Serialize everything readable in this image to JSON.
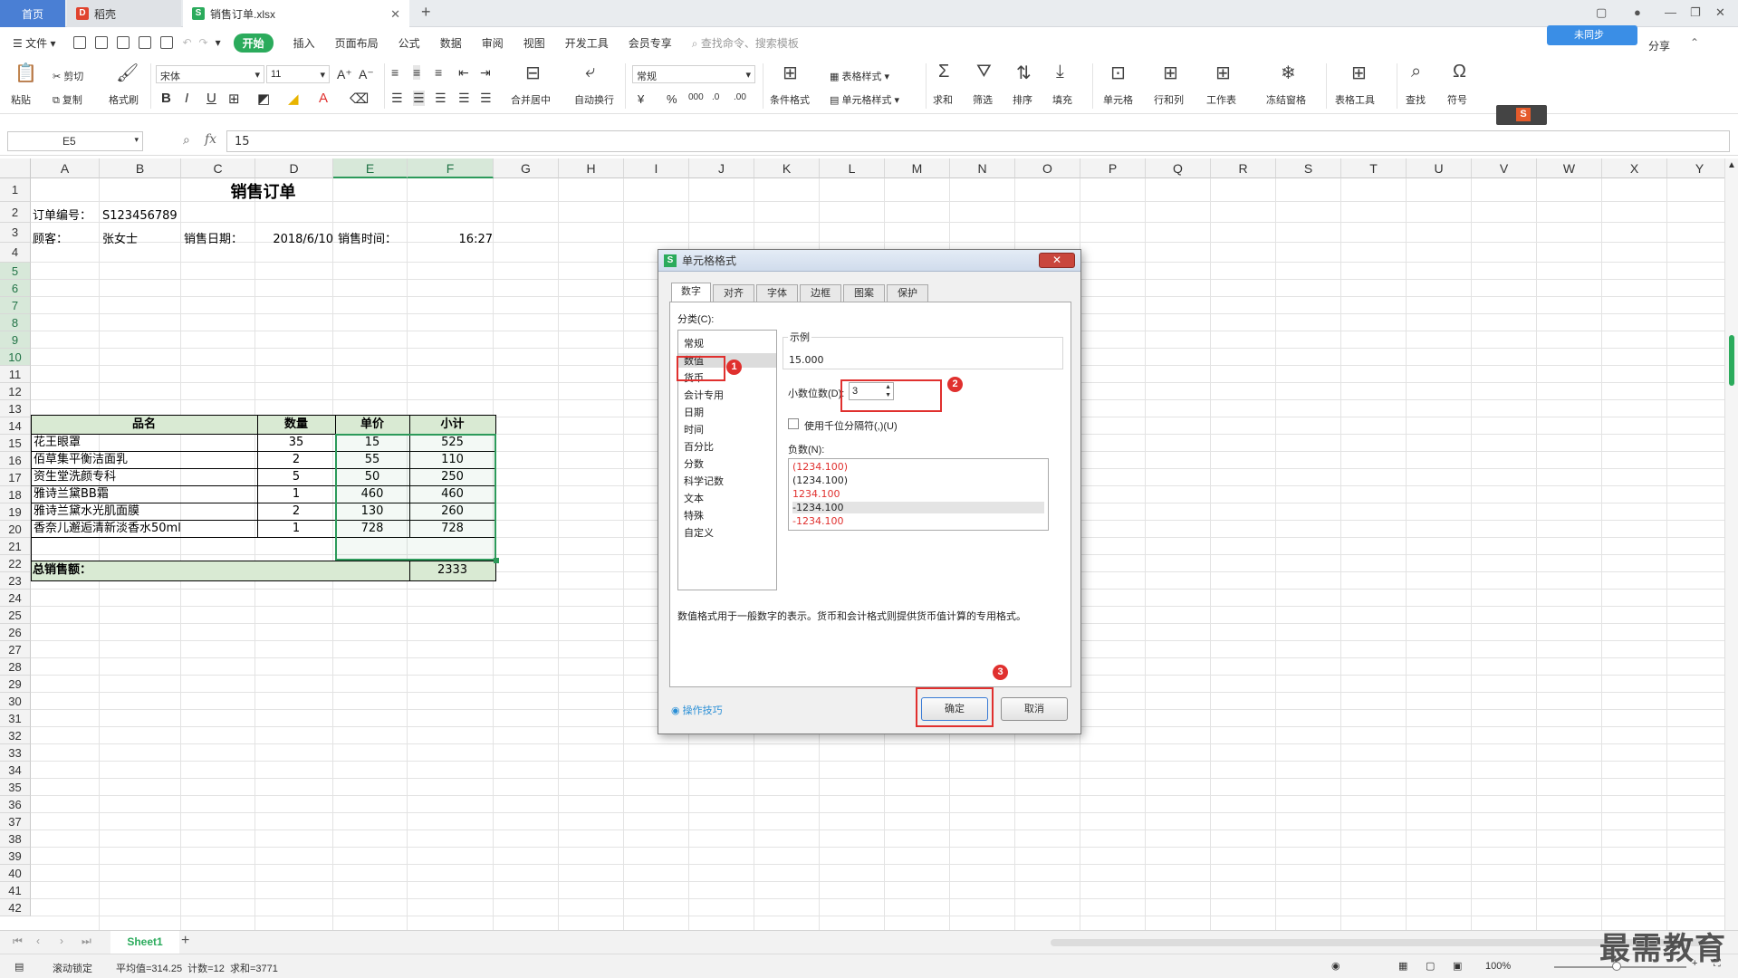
{
  "tabs": {
    "home": "首页",
    "daoke": "稻壳",
    "file": "销售订单.xlsx",
    "new_tab": "+"
  },
  "menu": {
    "file": "文件",
    "items": [
      "开始",
      "插入",
      "页面布局",
      "公式",
      "数据",
      "审阅",
      "视图",
      "开发工具",
      "会员专享"
    ],
    "search_placeholder": "查找命令、搜索模板",
    "cloud_badge": "未同步",
    "share": "分享"
  },
  "ribbon": {
    "paste": "粘贴",
    "cut": "剪切",
    "copy": "复制",
    "format_painter": "格式刷",
    "font_name": "宋体",
    "font_size": "11",
    "merge_center": "合并居中",
    "wrap": "自动换行",
    "number_format": "常规",
    "cond_format": "条件格式",
    "table_style": "表格样式",
    "cell_style": "单元格样式",
    "sum": "求和",
    "filter": "筛选",
    "sort": "排序",
    "fill": "填充",
    "cell": "单元格",
    "row_col": "行和列",
    "worksheet": "工作表",
    "freeze": "冻结窗格",
    "table_tools": "表格工具",
    "find": "查找",
    "symbol": "符号"
  },
  "formula_bar": {
    "cell_ref": "E5",
    "fx": "fx",
    "value": "15"
  },
  "columns": [
    "A",
    "B",
    "C",
    "D",
    "E",
    "F",
    "G",
    "H",
    "I",
    "J",
    "K",
    "L",
    "M",
    "N",
    "O",
    "P",
    "Q",
    "R",
    "S",
    "T",
    "U",
    "V",
    "W",
    "X",
    "Y"
  ],
  "rows": [
    "1",
    "2",
    "3",
    "4",
    "5",
    "6",
    "7",
    "8",
    "9",
    "10",
    "11",
    "12",
    "13",
    "14",
    "15",
    "16",
    "17",
    "18",
    "19",
    "20",
    "21",
    "22",
    "23",
    "24",
    "25",
    "26",
    "27",
    "28",
    "29",
    "30",
    "31",
    "32",
    "33",
    "34",
    "35",
    "36",
    "37",
    "38",
    "39",
    "40",
    "41",
    "42"
  ],
  "sheet": {
    "title": "销售订单",
    "order_label": "订单编号：",
    "order_no": "S123456789",
    "customer_label": "顾客：",
    "customer": "张女士",
    "date_label": "销售日期：",
    "date": "2018/6/10",
    "time_label": "销售时间：",
    "time": "16:27",
    "headers": [
      "品名",
      "数量",
      "单价",
      "小计"
    ],
    "items": [
      {
        "name": "花王眼罩",
        "qty": "35",
        "price": "15",
        "subtotal": "525"
      },
      {
        "name": "佰草集平衡洁面乳",
        "qty": "2",
        "price": "55",
        "subtotal": "110"
      },
      {
        "name": "资生堂洗颜专科",
        "qty": "5",
        "price": "50",
        "subtotal": "250"
      },
      {
        "name": "雅诗兰黛BB霜",
        "qty": "1",
        "price": "460",
        "subtotal": "460"
      },
      {
        "name": "雅诗兰黛水光肌面膜",
        "qty": "2",
        "price": "130",
        "subtotal": "260"
      },
      {
        "name": "香奈儿邂逅清新淡香水50ml",
        "qty": "1",
        "price": "728",
        "subtotal": "728"
      }
    ],
    "total_label": "总销售额：",
    "total": "2333"
  },
  "dialog": {
    "title": "单元格格式",
    "tabs": [
      "数字",
      "对齐",
      "字体",
      "边框",
      "图案",
      "保护"
    ],
    "category_label": "分类(C):",
    "categories": [
      "常规",
      "数值",
      "货币",
      "会计专用",
      "日期",
      "时间",
      "百分比",
      "分数",
      "科学记数",
      "文本",
      "特殊",
      "自定义"
    ],
    "sample_label": "示例",
    "sample_value": "15.000",
    "decimal_label": "小数位数(D):",
    "decimal_value": "3",
    "thousands_label": "使用千位分隔符(,)(U)",
    "negative_label": "负数(N):",
    "negatives": [
      "(1234.100)",
      "(1234.100)",
      "1234.100",
      "-1234.100",
      "-1234.100"
    ],
    "description": "数值格式用于一般数字的表示。货币和会计格式则提供货币值计算的专用格式。",
    "tips": "操作技巧",
    "ok": "确定",
    "cancel": "取消",
    "badges": [
      "1",
      "2",
      "3"
    ]
  },
  "sheet_tab": "Sheet1",
  "status": {
    "scroll_lock": "滚动锁定",
    "summary": "平均值=314.25  计数=12  求和=3771",
    "zoom": "100%"
  },
  "watermark": "最需教育",
  "colors": {
    "accent_green": "#2bab5c",
    "selection_green": "#2c9a5a",
    "header_fill": "#d9ead3",
    "annotation_red": "#e0302e",
    "negative_red": "#e0302e"
  }
}
